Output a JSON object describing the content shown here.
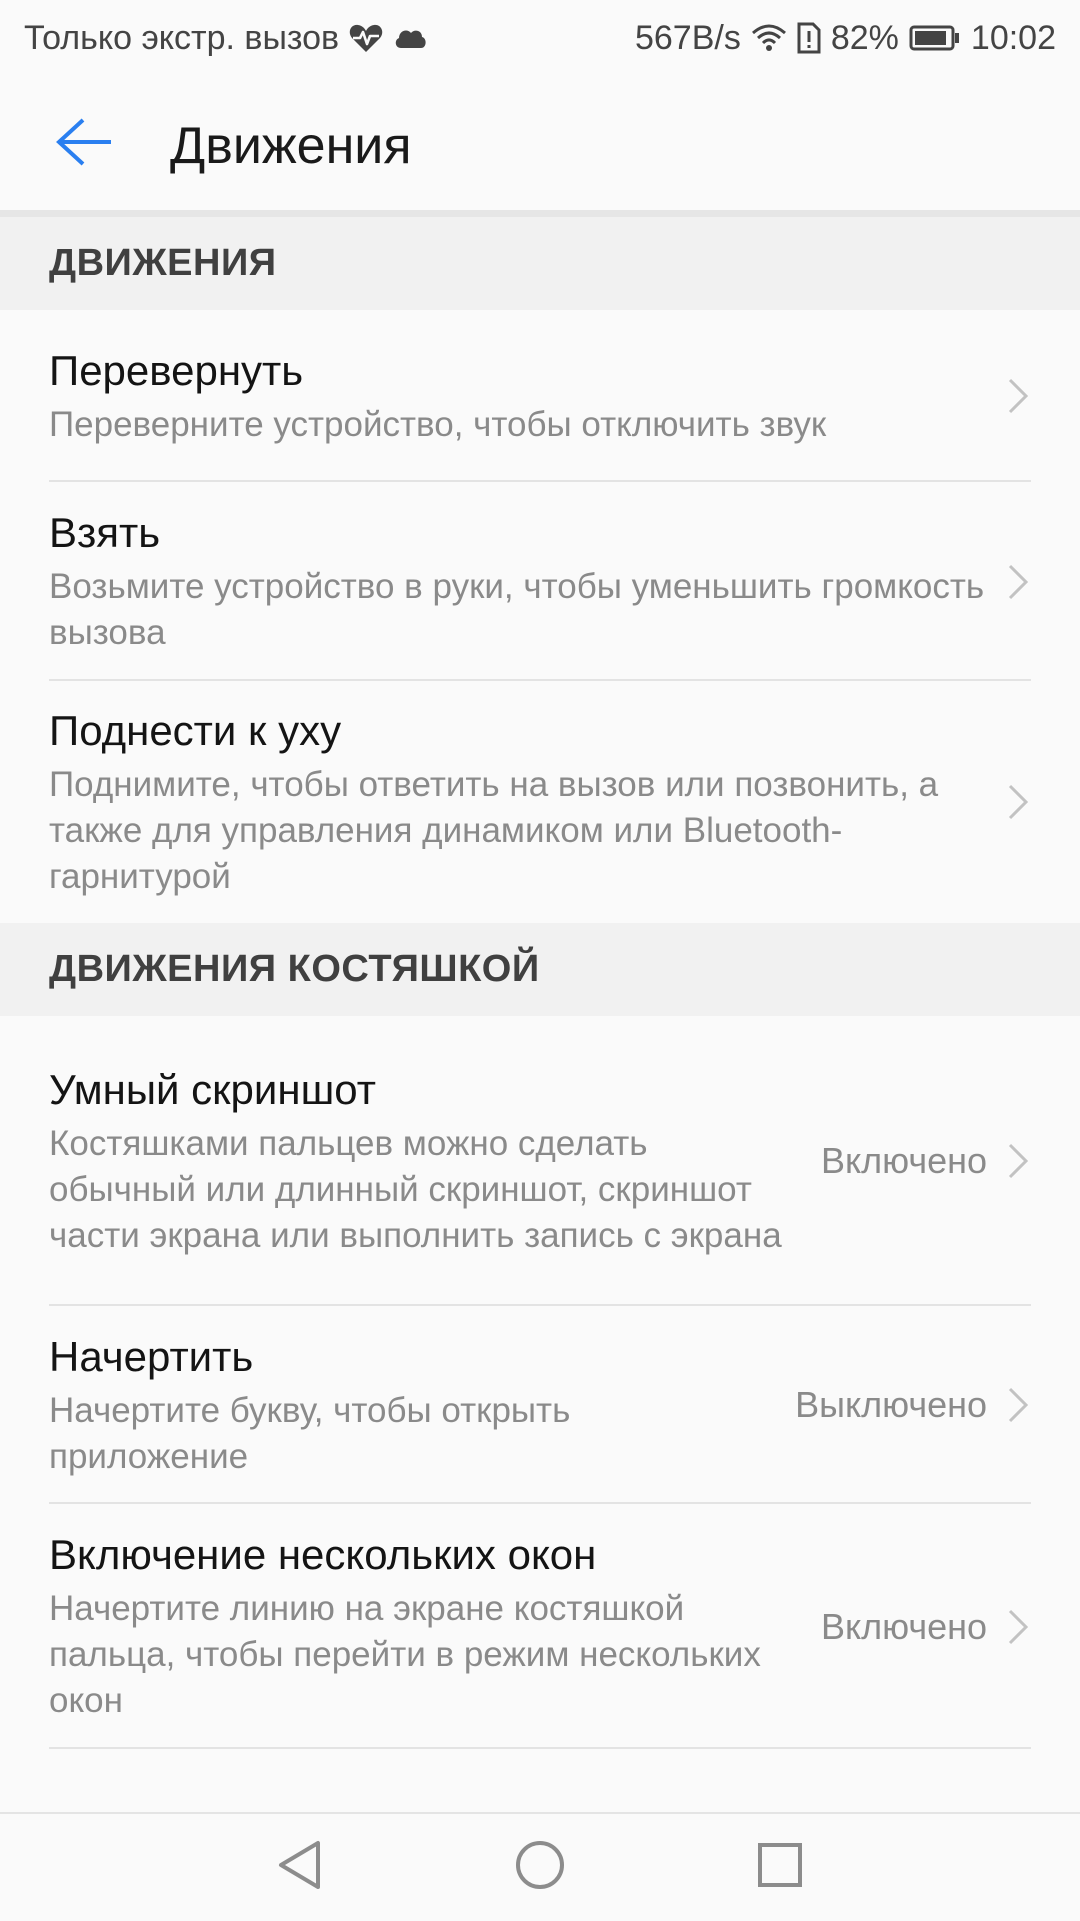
{
  "status_bar": {
    "carrier_text": "Только экстр. вызов",
    "network_speed": "567B/s",
    "battery_percent": "82%",
    "time": "10:02",
    "icons": [
      "heartbeat-icon",
      "cloud-icon",
      "wifi-icon",
      "sim-alert-icon",
      "battery-icon"
    ]
  },
  "app_bar": {
    "title": "Движения",
    "back_icon": "arrow-left-icon",
    "accent_color": "#2a7ff0"
  },
  "sections": [
    {
      "header": "ДВИЖЕНИЯ",
      "items": [
        {
          "title": "Перевернуть",
          "summary": "Переверните устройство, чтобы отключить звук",
          "status": ""
        },
        {
          "title": "Взять",
          "summary": "Возьмите устройство в руки, чтобы уменьшить громкость вызова",
          "status": ""
        },
        {
          "title": "Поднести к уху",
          "summary": "Поднимите, чтобы ответить на вызов или позвонить, а также для управления динамиком или Bluetooth-гарнитурой",
          "status": ""
        }
      ]
    },
    {
      "header": "ДВИЖЕНИЯ КОСТЯШКОЙ",
      "items": [
        {
          "title": "Умный скриншот",
          "summary": "Костяшками пальцев можно сделать обычный или длинный скриншот, скриншот части экрана или выполнить запись с экрана",
          "status": "Включено"
        },
        {
          "title": "Начертить",
          "summary": "Начертите букву, чтобы открыть приложение",
          "status": "Выключено"
        },
        {
          "title": "Включение нескольких окон",
          "summary": "Начертите линию на экране костяшкой пальца, чтобы перейти в режим нескольких окон",
          "status": "Включено"
        }
      ]
    }
  ],
  "nav_bar": {
    "icons": [
      "back-triangle-icon",
      "home-circle-icon",
      "recents-square-icon"
    ]
  }
}
